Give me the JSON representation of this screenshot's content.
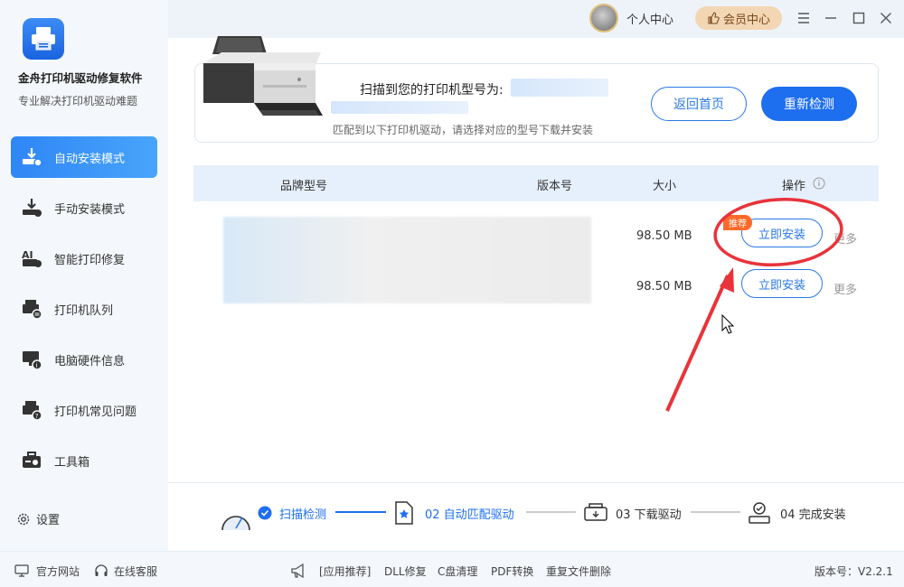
{
  "app": {
    "name": "金舟打印机驱动修复软件",
    "subtitle": "专业解决打印机驱动难题"
  },
  "sidebar": {
    "items": [
      {
        "label": "自动安装模式",
        "active": true,
        "icon": "auto-install-icon"
      },
      {
        "label": "手动安装模式",
        "active": false,
        "icon": "manual-install-icon"
      },
      {
        "label": "智能打印修复",
        "active": false,
        "icon": "repair-icon"
      },
      {
        "label": "打印机队列",
        "active": false,
        "icon": "queue-icon"
      },
      {
        "label": "电脑硬件信息",
        "active": false,
        "icon": "hardware-icon"
      },
      {
        "label": "打印机常见问题",
        "active": false,
        "icon": "faq-icon"
      },
      {
        "label": "工具箱",
        "active": false,
        "icon": "toolbox-icon"
      }
    ],
    "settings_label": "设置"
  },
  "topbar": {
    "user_center": "个人中心",
    "vip_center": "会员中心"
  },
  "scan": {
    "title": "扫描到您的打印机型号为:",
    "description": "匹配到以下打印机驱动，请选择对应的型号下载并安装",
    "home_button": "返回首页",
    "rescan_button": "重新检测"
  },
  "table": {
    "headers": [
      "品牌型号",
      "版本号",
      "大小",
      "操作"
    ],
    "rows": [
      {
        "size": "98.50 MB",
        "action": "立即安装",
        "more": "更多",
        "badge": "推荐"
      },
      {
        "size": "98.50 MB",
        "action": "立即安装",
        "more": "更多"
      }
    ]
  },
  "steps": [
    {
      "label": "扫描检测",
      "state": "done"
    },
    {
      "label": "02 自动匹配驱动",
      "state": "active"
    },
    {
      "label": "03 下载驱动",
      "state": "pending"
    },
    {
      "label": "04 完成安装",
      "state": "pending"
    }
  ],
  "footer": {
    "website": "官方网站",
    "support": "在线客服",
    "links": [
      "[应用推荐]",
      "DLL修复",
      "C盘清理",
      "PDF转换",
      "重复文件删除"
    ],
    "version": "版本号：V2.2.1"
  },
  "colors": {
    "primary": "#1e6ef0",
    "accent_orange": "#ff6a2a",
    "annotation_red": "#e8333a"
  }
}
